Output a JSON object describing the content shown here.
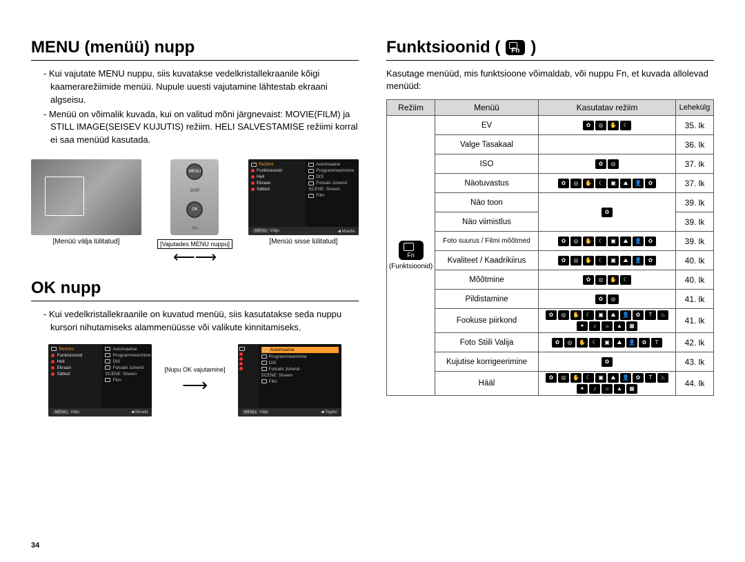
{
  "page_number": "34",
  "left": {
    "section1_title": "MENU (menüü) nupp",
    "section1_para1": "- Kui vajutate MENU nuppu, siis kuvatakse vedelkristallekraanile kõigi kaamerarežiimide menüü. Nupule uuesti vajutamine lähtestab ekraani algseisu.",
    "section1_para2": "- Menüü on võimalik kuvada, kui on valitud mõni järgnevaist: MOVIE(FILM) ja STILL IMAGE(SEISEV KUJUTIS) režiim. HELI SALVESTAMISE režiimi korral ei saa menüüd kasutada.",
    "shot_left_caption": "[Menüü välja lülitatud]",
    "shot_mid_label": "[Vajutades MENU nuppu]",
    "shot_right_caption": "[Menüü sisse lülitatud]",
    "btn_menu": "MENU",
    "btn_disp": "DISP",
    "btn_ok": "OK",
    "btn_fn": "Fn",
    "section2_title": "OK nupp",
    "section2_para": "- Kui vedelkristallekraanile on kuvatud menüü, siis kasutatakse seda nuppu kursori nihutamiseks alammenüüsse või valikute kinnitamiseks.",
    "ok_arrow_label": "[Nupu OK vajutamine]",
    "menu_scr": {
      "left_title": "Režiimi",
      "items_left": [
        "Funktsioonid",
        "Heli",
        "Ekraan",
        "Sätted"
      ],
      "items_right": [
        "Automaatne",
        "Programmeerimine",
        "DIS",
        "Fotoabi Juhend",
        "Stseen",
        "Film"
      ],
      "bar_exit": "Välju",
      "bar_change": "Muuda",
      "bar_back": "Tagasi",
      "menu_tag": "MENU",
      "scene_tag": "SCENE"
    }
  },
  "right": {
    "title_text": "Funktsioonid (",
    "title_close": ")",
    "intro": "Kasutage menüüd, mis funktsioone võimaldab, või nuppu Fn, et kuvada allolevad menüüd:",
    "headers": {
      "mode": "Režiim",
      "menu": "Menüü",
      "applicable": "Kasutatav režiim",
      "page": "Lehekülg"
    },
    "mode_label": "(Funktsioonid)",
    "rows": [
      {
        "menu": "EV",
        "icons": 4,
        "page": "35. lk"
      },
      {
        "menu": "Valge Tasakaal",
        "icons": 0,
        "page": "36. lk"
      },
      {
        "menu": "ISO",
        "icons": 2,
        "page": "37. lk"
      },
      {
        "menu": "Näotuvastus",
        "icons": 8,
        "page": "37. lk"
      },
      {
        "menu": "Näo toon",
        "icons": 1,
        "page": "39. lk",
        "merge_below": true
      },
      {
        "menu": "Näo viimistlus",
        "icons": 0,
        "page": "39. lk",
        "merged": true
      },
      {
        "menu": "Foto suurus / Filmi mõõtmed",
        "icons": 8,
        "page": "39. lk",
        "small": true
      },
      {
        "menu": "Kvaliteet / Kaadrikiirus",
        "icons": 8,
        "page": "40. lk"
      },
      {
        "menu": "Mõõtmine",
        "icons": 4,
        "page": "40. lk"
      },
      {
        "menu": "Pildistamine",
        "icons": 2,
        "page": "41. lk"
      },
      {
        "menu": "Fookuse piirkond",
        "icons": 15,
        "page": "41. lk"
      },
      {
        "menu": "Foto Stiili Valija",
        "icons": 9,
        "page": "42. lk"
      },
      {
        "menu": "Kujutise korrigeerimine",
        "icons": 1,
        "page": "43. lk"
      },
      {
        "menu": "Hääl",
        "icons": 15,
        "page": "44. lk"
      }
    ]
  }
}
